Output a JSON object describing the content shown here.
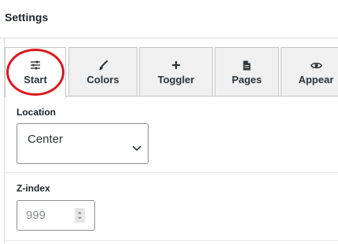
{
  "header": {
    "title": "Settings"
  },
  "tabs": [
    {
      "label": "Start",
      "icon": "sliders-icon",
      "active": true
    },
    {
      "label": "Colors",
      "icon": "paintbrush-icon"
    },
    {
      "label": "Toggler",
      "icon": "plus-icon"
    },
    {
      "label": "Pages",
      "icon": "page-icon"
    },
    {
      "label": "Appear",
      "icon": "eye-icon"
    }
  ],
  "highlight_color": "#e0161b",
  "fields": {
    "location": {
      "label": "Location",
      "value": "Center"
    },
    "zindex": {
      "label": "Z-index",
      "placeholder": "999"
    }
  }
}
